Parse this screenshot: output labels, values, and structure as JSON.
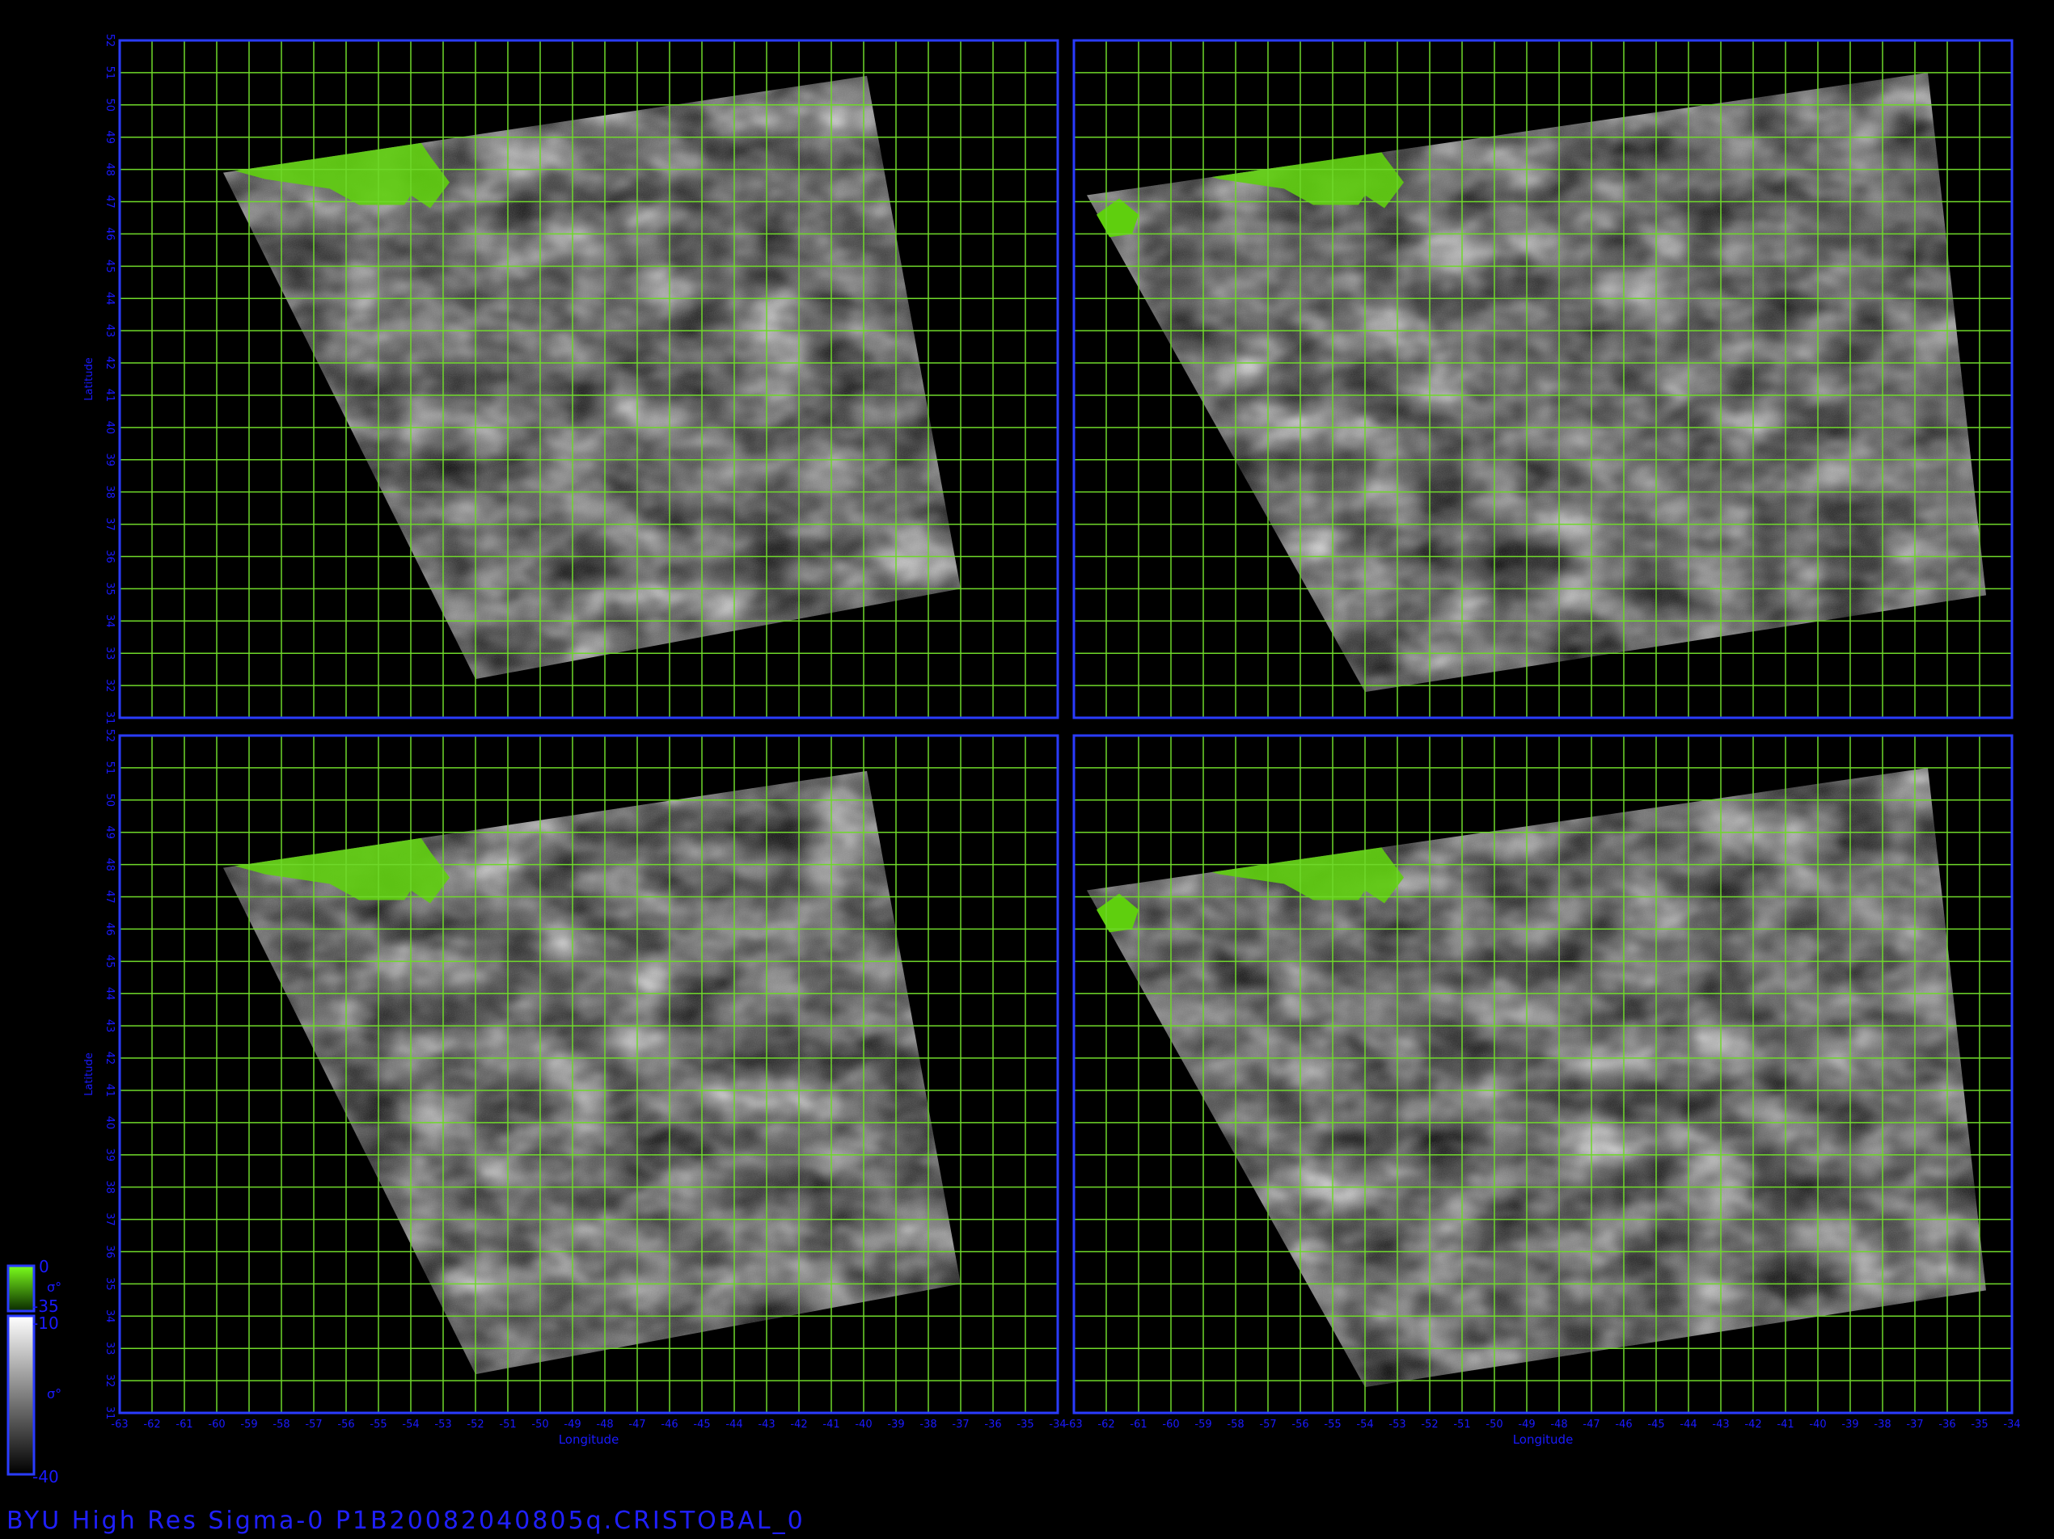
{
  "caption": "BYU  High  Res  Sigma-0  P1B20082040805q.CRISTOBAL_0",
  "colors": {
    "background": "#000000",
    "frame": "#2a3cff",
    "grid": "#6fd82a",
    "axis_text": "#1a1aff",
    "land": "#5fcf0e"
  },
  "axes": {
    "x_label": "Longitude",
    "y_label": "Latitude",
    "x_ticks": [
      "-63",
      "-62",
      "-61",
      "-60",
      "-59",
      "-58",
      "-57",
      "-56",
      "-55",
      "-54",
      "-53",
      "-52",
      "-51",
      "-50",
      "-49",
      "-48",
      "-47",
      "-46",
      "-45",
      "-44",
      "-43",
      "-42",
      "-41",
      "-40",
      "-39",
      "-38",
      "-37",
      "-36",
      "-35",
      "-34"
    ],
    "y_ticks": [
      "31",
      "32",
      "33",
      "34",
      "35",
      "36",
      "37",
      "38",
      "39",
      "40",
      "41",
      "42",
      "43",
      "44",
      "45",
      "46",
      "47",
      "48",
      "49",
      "50",
      "51",
      "52"
    ],
    "x_range": [
      -63,
      -34
    ],
    "y_range": [
      31,
      52
    ]
  },
  "colorbars": [
    {
      "name": "land",
      "top_label": "0",
      "bottom_label": "-35",
      "symbol": "σ°"
    },
    {
      "name": "ocean",
      "top_label": "-10",
      "bottom_label": "-40",
      "symbol": "σ°"
    }
  ],
  "panels": [
    {
      "id": "top-left",
      "swath": [
        [
          -59.8,
          47.9
        ],
        [
          -39.9,
          50.9
        ],
        [
          -37.0,
          35.0
        ],
        [
          -52.0,
          32.2
        ]
      ],
      "island": false
    },
    {
      "id": "top-right",
      "swath": [
        [
          -62.6,
          47.2
        ],
        [
          -36.6,
          51.0
        ],
        [
          -34.8,
          34.8
        ],
        [
          -54.0,
          31.8
        ]
      ],
      "island": true
    },
    {
      "id": "bottom-left",
      "swath": [
        [
          -59.8,
          47.9
        ],
        [
          -39.9,
          50.9
        ],
        [
          -37.0,
          35.0
        ],
        [
          -52.0,
          32.2
        ]
      ],
      "island": false
    },
    {
      "id": "bottom-right",
      "swath": [
        [
          -62.6,
          47.2
        ],
        [
          -36.6,
          51.0
        ],
        [
          -34.8,
          34.8
        ],
        [
          -54.0,
          31.8
        ]
      ],
      "island": true
    }
  ]
}
